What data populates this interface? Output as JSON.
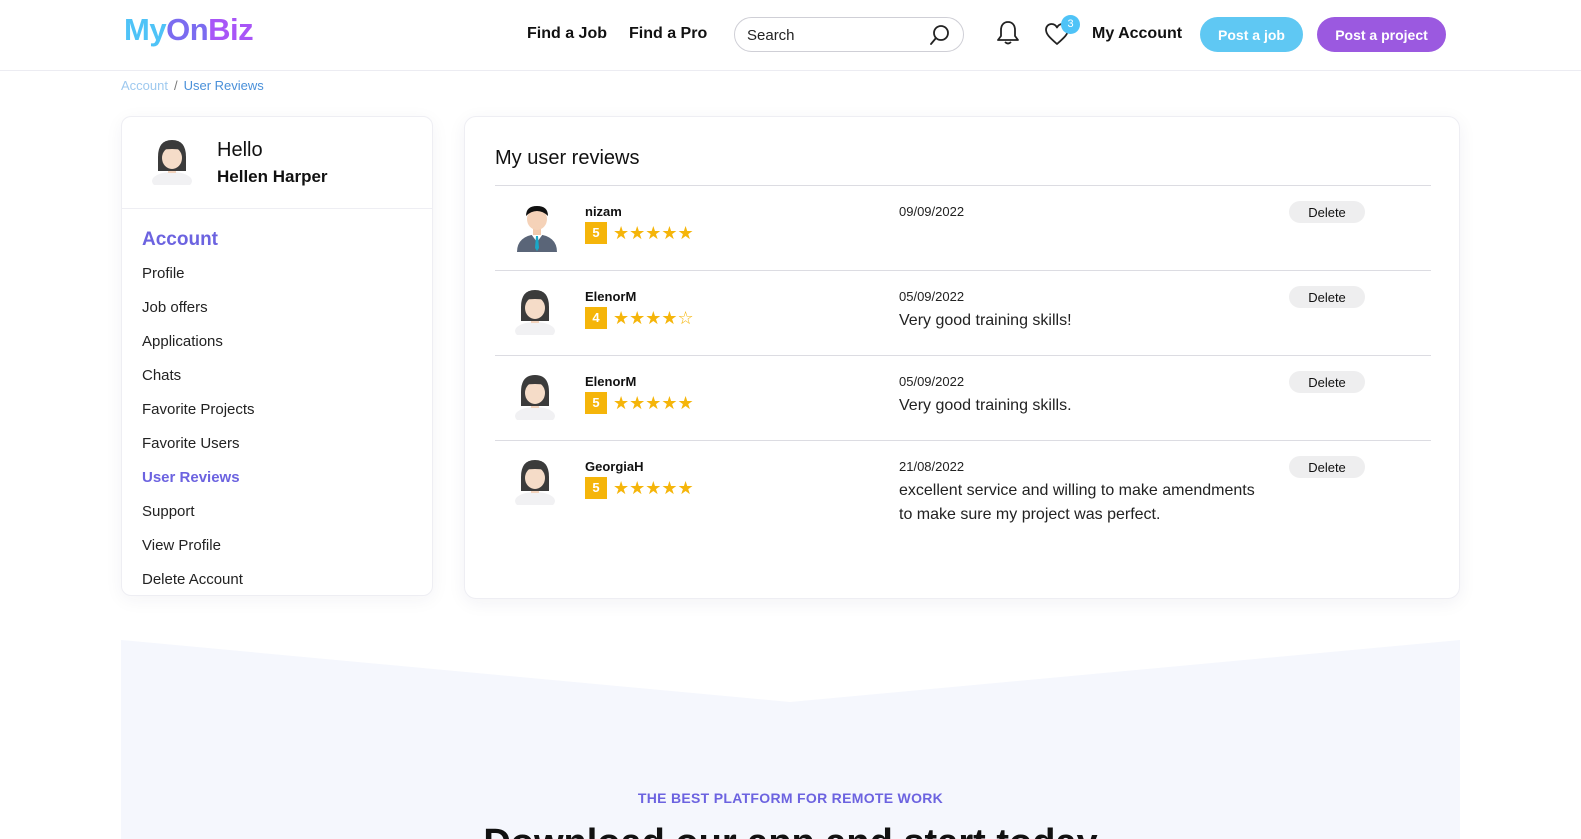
{
  "header": {
    "logo": {
      "part1": "My",
      "part2": "On",
      "part3": "Biz"
    },
    "nav": [
      "Find a Job",
      "Find a Pro"
    ],
    "search": {
      "placeholder": "Search",
      "icon": "search-icon"
    },
    "notifications_icon": "bell-icon",
    "favorites": {
      "icon": "heart-icon",
      "count": "3"
    },
    "my_account": "My Account",
    "post_job": "Post a job",
    "post_project": "Post a project",
    "colors": {
      "post_job": "#5fc8f3",
      "post_project": "#9b59e0"
    }
  },
  "breadcrumb": {
    "root": "Account",
    "separator": "/",
    "current": "User Reviews"
  },
  "sidebar": {
    "hello": "Hello",
    "user_name": "Hellen Harper",
    "heading": "Account",
    "items": [
      {
        "label": "Profile",
        "active": false
      },
      {
        "label": "Job offers",
        "active": false
      },
      {
        "label": "Applications",
        "active": false
      },
      {
        "label": "Chats",
        "active": false
      },
      {
        "label": "Favorite Projects",
        "active": false
      },
      {
        "label": "Favorite Users",
        "active": false
      },
      {
        "label": "User Reviews",
        "active": true
      },
      {
        "label": "Support",
        "active": false
      },
      {
        "label": "View Profile",
        "active": false
      },
      {
        "label": "Delete Account",
        "active": false
      }
    ],
    "accent": "#6c63e0"
  },
  "reviews": {
    "title": "My user reviews",
    "delete_label": "Delete",
    "star_color": "#f5b50a",
    "items": [
      {
        "user": "nizam",
        "score": "5",
        "stars": 5,
        "date": "09/09/2022",
        "text": "",
        "avatar": "man-avatar-icon"
      },
      {
        "user": "ElenorM",
        "score": "4",
        "stars": 4,
        "date": "05/09/2022",
        "text": "Very good training skills!",
        "avatar": "woman-avatar-icon"
      },
      {
        "user": "ElenorM",
        "score": "5",
        "stars": 5,
        "date": "05/09/2022",
        "text": "Very good training skills.",
        "avatar": "woman-avatar-icon"
      },
      {
        "user": "GeorgiaH",
        "score": "5",
        "stars": 5,
        "date": "21/08/2022",
        "text": "excellent service and willing to make amendments to make sure my project was perfect.",
        "avatar": "woman-avatar-icon"
      }
    ]
  },
  "promo": {
    "kicker": "THE BEST PLATFORM FOR REMOTE WORK",
    "title": "Download our app and start today"
  }
}
